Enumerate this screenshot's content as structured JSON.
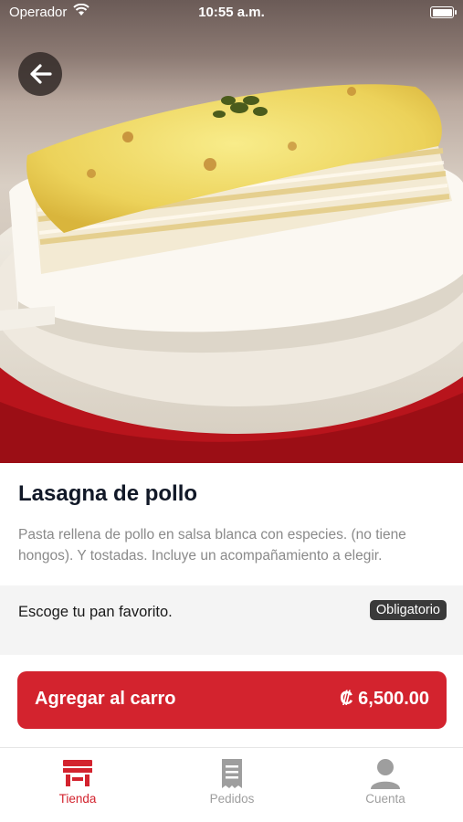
{
  "status_bar": {
    "carrier": "Operador",
    "time": "10:55 a.m."
  },
  "product": {
    "title": "Lasagna de pollo",
    "description": "Pasta rellena de pollo en salsa blanca con especies. (no tiene hongos). Y tostadas. Incluye un acompañamiento a elegir."
  },
  "option": {
    "label": "Escoge tu pan favorito.",
    "badge": "Obligatorio"
  },
  "cart_button": {
    "label": "Agregar al carro",
    "price": "₡ 6,500.00"
  },
  "tabs": [
    {
      "label": "Tienda",
      "icon": "store-icon",
      "active": true
    },
    {
      "label": "Pedidos",
      "icon": "receipt-icon",
      "active": false
    },
    {
      "label": "Cuenta",
      "icon": "user-icon",
      "active": false
    }
  ],
  "colors": {
    "accent": "#d3232e",
    "badge": "#3a3a3a",
    "inactive": "#9e9e9e"
  }
}
